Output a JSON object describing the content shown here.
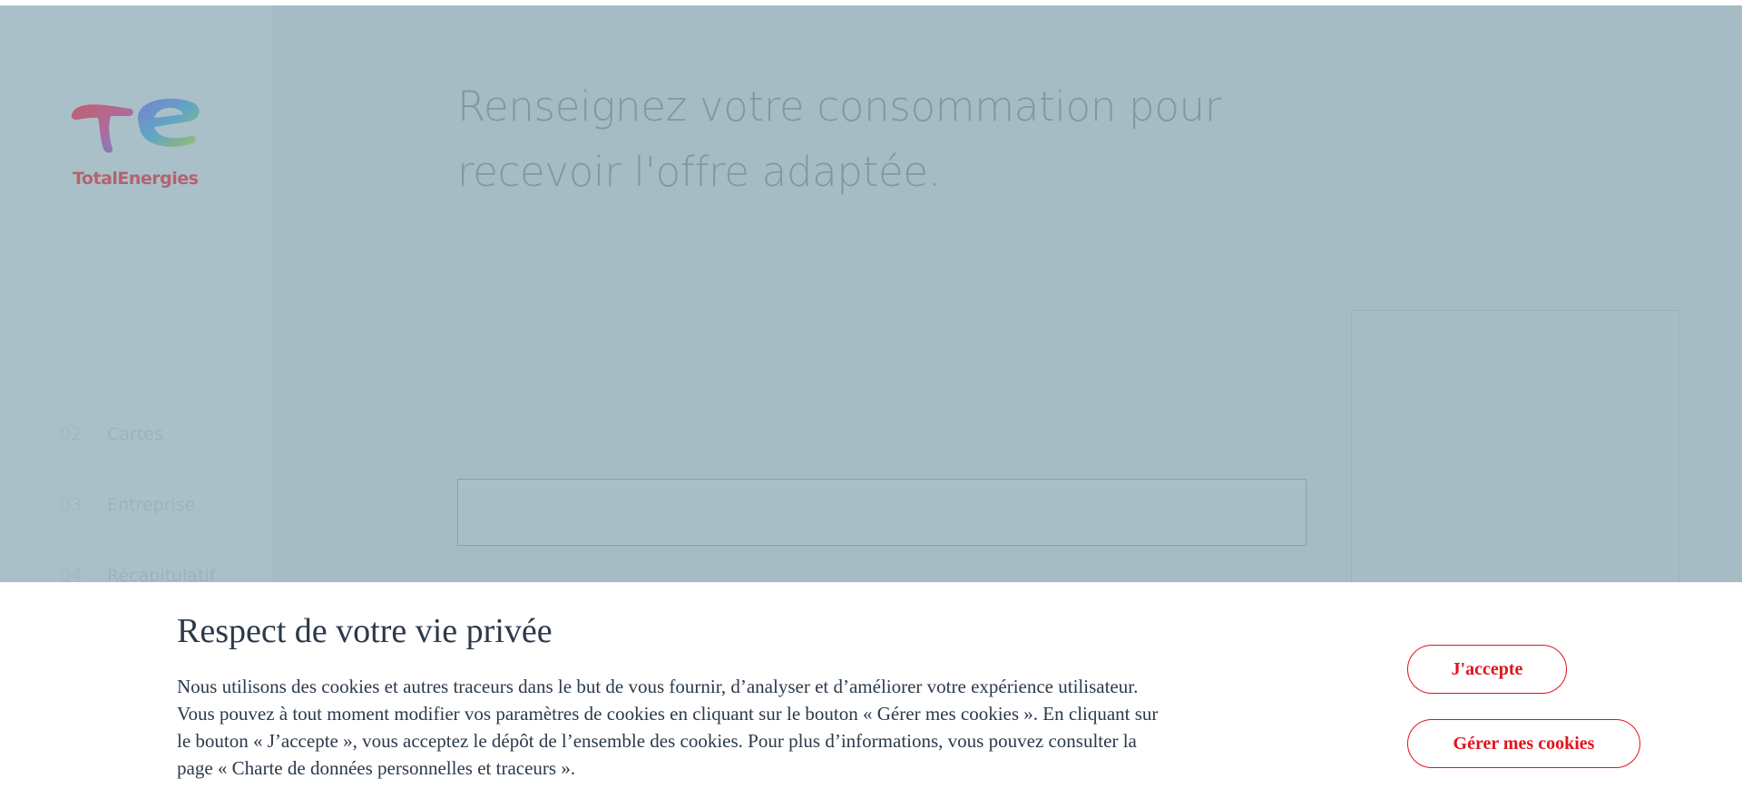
{
  "brand": {
    "name": "TotalEnergies"
  },
  "sidebar": {
    "steps": [
      {
        "number": "02",
        "label": "Cartes"
      },
      {
        "number": "03",
        "label": "Entreprise"
      },
      {
        "number": "04",
        "label": "Récapitulatif"
      }
    ]
  },
  "main": {
    "heading_line1": "Renseignez votre consommation pour",
    "heading_line2": "recevoir l'offre adaptée."
  },
  "cookie_banner": {
    "title": "Respect de votre vie privée",
    "text_lines": [
      "Nous utilisons des cookies et autres traceurs dans le but de vous fournir, d’analyser et d’améliorer votre expérience utilisateur.",
      "Vous pouvez à tout moment modifier vos paramètres de cookies en cliquant sur le bouton « Gérer mes cookies ». En cliquant sur",
      "le bouton « J’accepte », vous acceptez le dépôt de l’ensemble des cookies. Pour plus d’informations, vous pouvez consulter la",
      "page « Charte de données personnelles et traceurs »."
    ],
    "accept_label": "J'accepte",
    "manage_label": "Gérer mes cookies"
  },
  "colors": {
    "overlay": "#a5bcc5",
    "accent_red": "#e2131c",
    "text_dark": "#2b3a4a"
  }
}
